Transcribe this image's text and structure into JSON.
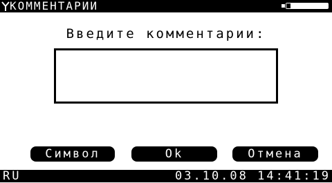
{
  "header": {
    "title": "КОММЕНТАРИИ",
    "signal_icon": "antenna-signal-icon",
    "battery_icon": "battery-icon"
  },
  "dialog": {
    "prompt": "Введите комментарии:",
    "comment_value": ""
  },
  "buttons": {
    "symbol": "Символ",
    "ok": "Ok",
    "cancel": "Отмена"
  },
  "status": {
    "language": "RU",
    "datetime": "03.10.08 14:41:19"
  },
  "colors": {
    "background": "#ffffff",
    "foreground": "#000000"
  }
}
